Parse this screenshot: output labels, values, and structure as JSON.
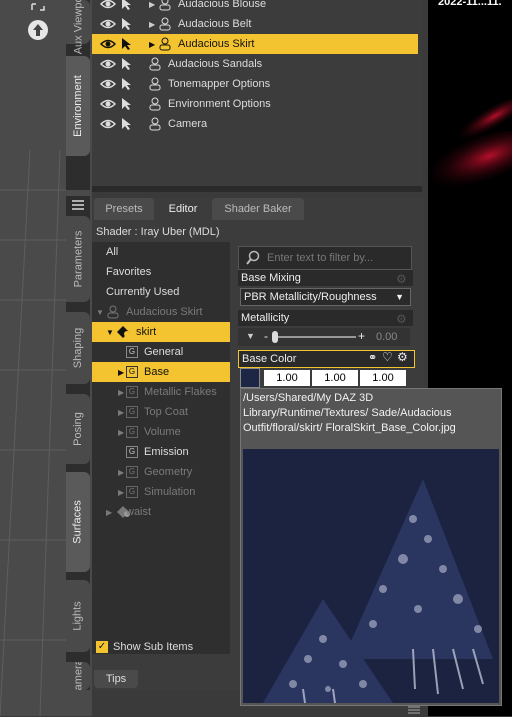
{
  "render": {
    "timestamp": "2022-11...11."
  },
  "top_tabs": [
    "Aux Viewport",
    "Environment"
  ],
  "scene_items": [
    {
      "label": "Audacious Blouse",
      "selected": false,
      "icon": "figure-icon"
    },
    {
      "label": "Audacious Belt",
      "selected": false,
      "icon": "figure-icon"
    },
    {
      "label": "Audacious Skirt",
      "selected": true,
      "icon": "figure-icon"
    },
    {
      "label": "Audacious Sandals",
      "selected": false,
      "icon": "figure-icon"
    },
    {
      "label": "Tonemapper Options",
      "selected": false,
      "icon": "node-icon"
    },
    {
      "label": "Environment Options",
      "selected": false,
      "icon": "landscape-icon"
    },
    {
      "label": "Camera",
      "selected": false,
      "icon": "camera-icon"
    }
  ],
  "left_tabs": [
    "Parameters",
    "Shaping",
    "Posing",
    "Surfaces",
    "Lights",
    "Cameras"
  ],
  "panel_tabs": [
    "Presets",
    "Editor",
    "Shader Baker"
  ],
  "shader_line": "Shader : Iray Uber (MDL)",
  "categories": [
    {
      "label": "All"
    },
    {
      "label": "Favorites"
    },
    {
      "label": "Currently Used"
    },
    {
      "label": "Audacious Skirt"
    },
    {
      "label": "skirt"
    },
    {
      "label": "General"
    },
    {
      "label": "Base"
    },
    {
      "label": "Metallic Flakes"
    },
    {
      "label": "Top Coat"
    },
    {
      "label": "Volume"
    },
    {
      "label": "Emission"
    },
    {
      "label": "Geometry"
    },
    {
      "label": "Simulation"
    },
    {
      "label": "waist"
    }
  ],
  "filter_placeholder": "Enter text to filter by...",
  "base_mixing": {
    "label": "Base Mixing",
    "value": "PBR Metallicity/Roughness"
  },
  "metallicity": {
    "label": "Metallicity",
    "value": "0.00"
  },
  "base_color": {
    "label": "Base Color",
    "r": "1.00",
    "g": "1.00",
    "b": "1.00"
  },
  "tooltip_path": "/Users/Shared/My DAZ 3D Library/Runtime/Textures/ Sade/Audacious Outfit/floral/skirt/ FloralSkirt_Base_Color.jpg",
  "show_sub_items": "Show Sub Items",
  "tips": "Tips"
}
